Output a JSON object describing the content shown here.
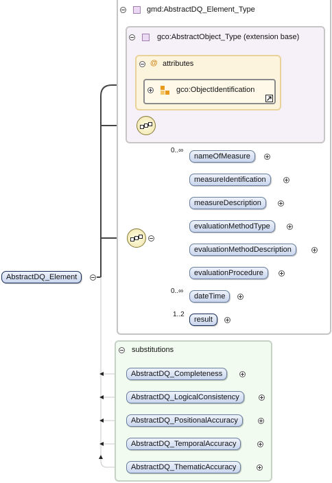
{
  "root": {
    "label": "AbstractDQ_Element"
  },
  "type_box": {
    "title": "gmd:AbstractDQ_Element_Type"
  },
  "ext_box": {
    "title": "gco:AbstractObject_Type (extension base)"
  },
  "attributes": {
    "title": "attributes",
    "symbol": "@",
    "group": "gco:ObjectIdentification"
  },
  "sequence": {
    "elements": [
      {
        "label": "nameOfMeasure",
        "card": "0..∞"
      },
      {
        "label": "measureIdentification",
        "card": ""
      },
      {
        "label": "measureDescription",
        "card": ""
      },
      {
        "label": "evaluationMethodType",
        "card": ""
      },
      {
        "label": "evaluationMethodDescription",
        "card": ""
      },
      {
        "label": "evaluationProcedure",
        "card": ""
      },
      {
        "label": "dateTime",
        "card": "0..∞"
      },
      {
        "label": "result",
        "card": "1..2"
      }
    ]
  },
  "substitutions": {
    "title": "substitutions",
    "items": [
      {
        "label": "AbstractDQ_Completeness"
      },
      {
        "label": "AbstractDQ_LogicalConsistency"
      },
      {
        "label": "AbstractDQ_PositionalAccuracy"
      },
      {
        "label": "AbstractDQ_TemporalAccuracy"
      },
      {
        "label": "AbstractDQ_ThematicAccuracy"
      }
    ]
  }
}
